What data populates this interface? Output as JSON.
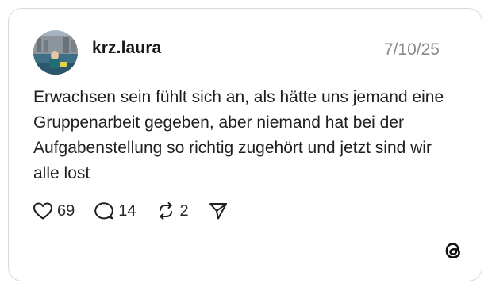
{
  "post": {
    "username": "krz.laura",
    "date": "7/10/25",
    "text": "Erwachsen sein fühlt sich an, als hätte uns jemand eine Gruppenarbeit gegeben, aber niemand hat bei der Aufgabenstellung so richtig zugehört und jetzt sind wir alle lost"
  },
  "actions": {
    "likes": "69",
    "replies": "14",
    "reposts": "2"
  },
  "icons": {
    "like": "heart-icon",
    "reply": "speech-bubble-icon",
    "repost": "repost-arrows-icon",
    "share": "paper-plane-icon",
    "brand": "threads-logo-icon"
  }
}
